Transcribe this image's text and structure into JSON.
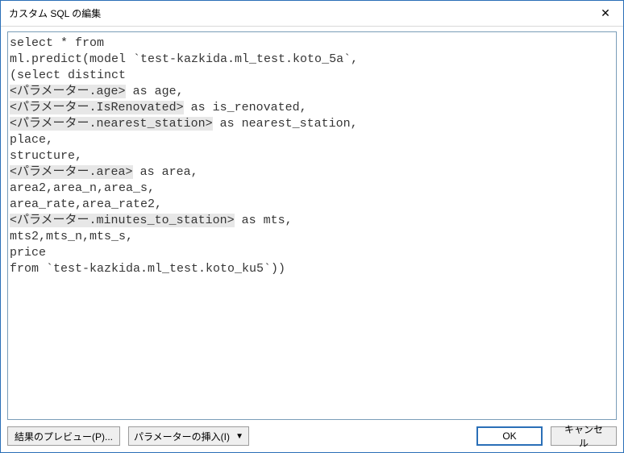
{
  "title": "カスタム SQL の編集",
  "sql": {
    "lines": [
      [
        {
          "t": "select * from"
        }
      ],
      [
        {
          "t": "ml.predict(model `test-kazkida.ml_test.koto_5a`,"
        }
      ],
      [
        {
          "t": "(select distinct"
        }
      ],
      [
        {
          "t": "<パラメーター.age>",
          "p": true
        },
        {
          "t": " as age,"
        }
      ],
      [
        {
          "t": "<パラメーター.IsRenovated>",
          "p": true
        },
        {
          "t": " as is_renovated,"
        }
      ],
      [
        {
          "t": "<パラメーター.nearest_station>",
          "p": true
        },
        {
          "t": " as nearest_station,"
        }
      ],
      [
        {
          "t": "place,"
        }
      ],
      [
        {
          "t": "structure,"
        }
      ],
      [
        {
          "t": "<パラメーター.area>",
          "p": true
        },
        {
          "t": " as area,"
        }
      ],
      [
        {
          "t": "area2,area_n,area_s,"
        }
      ],
      [
        {
          "t": "area_rate,area_rate2,"
        }
      ],
      [
        {
          "t": "<パラメーター.minutes_to_station>",
          "p": true
        },
        {
          "t": " as mts,"
        }
      ],
      [
        {
          "t": "mts2,mts_n,mts_s,"
        }
      ],
      [
        {
          "t": "price"
        }
      ],
      [
        {
          "t": "from `test-kazkida.ml_test.koto_ku5`))"
        }
      ]
    ]
  },
  "buttons": {
    "preview": "結果のプレビュー(P)...",
    "insert_param": "パラメーターの挿入(I)",
    "ok": "OK",
    "cancel": "キャンセル"
  },
  "icons": {
    "close": "✕",
    "dropdown": "▼"
  }
}
